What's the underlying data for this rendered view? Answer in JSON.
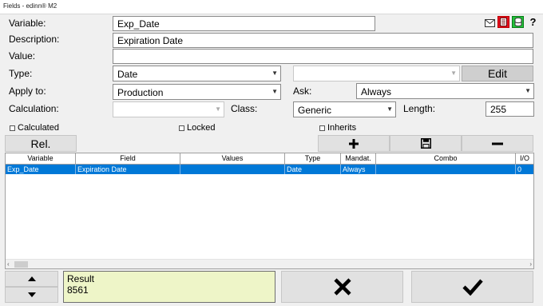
{
  "window": {
    "title": "Fields - edinn® M2"
  },
  "toolbar_icons": [
    "mail-icon",
    "red-document-icon",
    "green-database-icon",
    "help-icon"
  ],
  "help_glyph": "?",
  "form": {
    "variable_label": "Variable:",
    "variable_value": "Exp_Date",
    "description_label": "Description:",
    "description_value": "Expiration Date",
    "value_label": "Value:",
    "value_value": "",
    "type_label": "Type:",
    "type_value": "Date",
    "type2_value": "",
    "edit_label": "Edit",
    "apply_label": "Apply to:",
    "apply_value": "Production",
    "ask_label": "Ask:",
    "ask_value": "Always",
    "calculation_label": "Calculation:",
    "calculation_value": "",
    "class_label": "Class:",
    "class_value": "Generic",
    "length_label": "Length:",
    "length_value": "255",
    "calculated_label": "Calculated",
    "locked_label": "Locked",
    "inherits_label": "Inherits",
    "rel_label": "Rel."
  },
  "table": {
    "headers": [
      "Variable",
      "Field",
      "Values",
      "Type",
      "Mandat.",
      "Combo",
      "I/O"
    ],
    "rows": [
      [
        "Exp_Date",
        "Expiration Date",
        "",
        "Date",
        "Always",
        "",
        "0"
      ]
    ]
  },
  "result": {
    "label": "Result",
    "value": "8561"
  },
  "colors": {
    "selection": "#0078d7",
    "result_bg": "#eef5c8",
    "edit_button": "#cfcfcf"
  }
}
